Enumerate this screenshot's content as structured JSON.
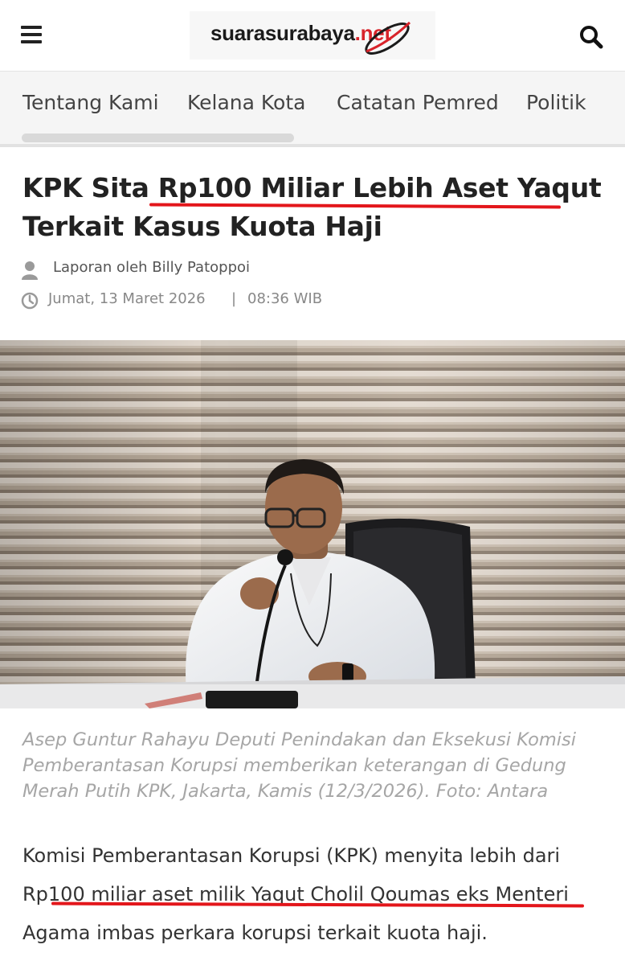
{
  "header": {
    "logo": {
      "name": "suarasurabaya",
      "tld": ".net"
    },
    "menu_icon": "hamburger-menu-icon",
    "search_icon": "search-icon"
  },
  "nav": {
    "items": [
      {
        "label": "Tentang Kami"
      },
      {
        "label": "Kelana Kota"
      },
      {
        "label": "Catatan Pemred"
      },
      {
        "label": "Politik"
      }
    ]
  },
  "article": {
    "title_part1": "KPK Sita ",
    "title_highlight": "Rp100 Miliar Lebih Aset Yaqut",
    "title_part2": "Terkait Kasus Kuota Haji",
    "author": "Laporan oleh Billy Patoppoi",
    "date": "Jumat, 13 Maret 2026",
    "time": "08:36 WIB",
    "caption": "Asep Guntur Rahayu Deputi Penindakan dan Eksekusi Komisi Pemberantasan Korupsi memberikan keterangan di Gedung Merah Putih KPK, Jakarta, Kamis (12/3/2026). Foto: Antara",
    "body": "Komisi Pemberantasan Korupsi (KPK) menyita lebih dari Rp100 miliar aset milik Yaqut Cholil Qoumas eks Menteri Agama imbas perkara korupsi terkait kuota haji.",
    "highlight_color": "#e3161b"
  }
}
